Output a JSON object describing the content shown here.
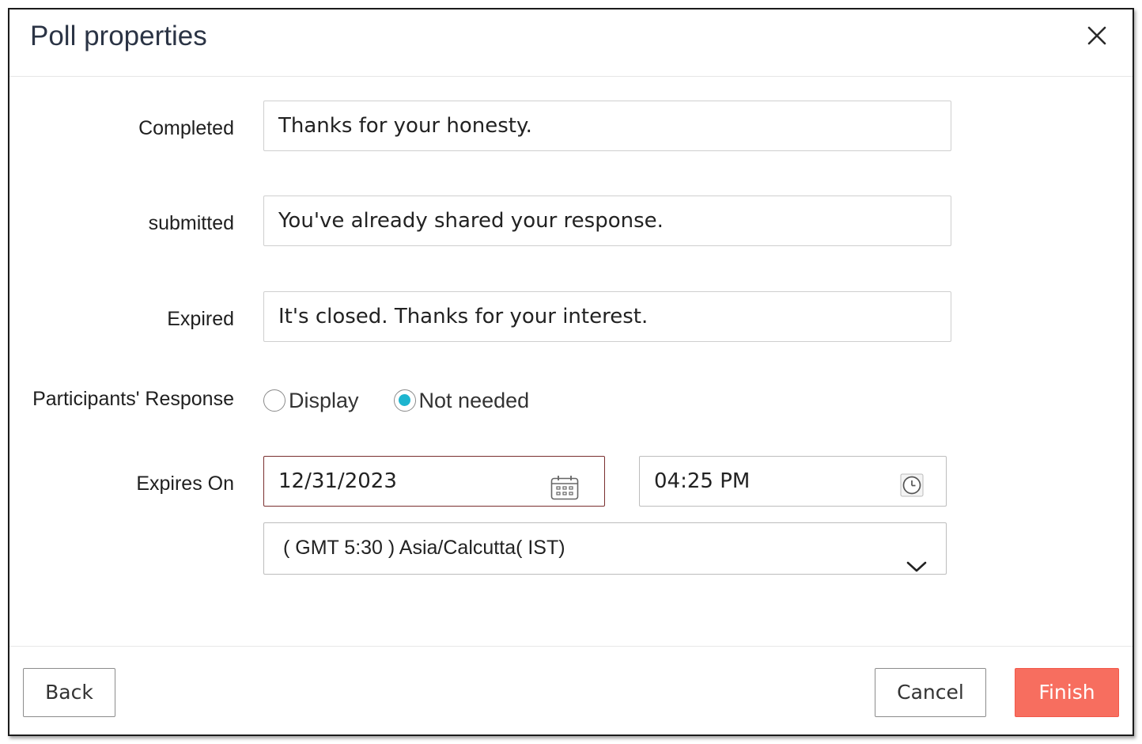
{
  "dialog": {
    "title": "Poll properties"
  },
  "form": {
    "completed": {
      "label": "Completed",
      "value": "Thanks for your honesty."
    },
    "submitted": {
      "label": "submitted",
      "value": "You've already shared your response."
    },
    "expired": {
      "label": "Expired",
      "value": "It's closed. Thanks for your interest."
    },
    "participants_response": {
      "label": "Participants' Response",
      "options": [
        "Display",
        "Not needed"
      ],
      "selected": "Not needed"
    },
    "expires_on": {
      "label": "Expires On",
      "date": "12/31/2023",
      "time": "04:25 PM",
      "timezone": "( GMT 5:30 ) Asia/Calcutta( IST)"
    }
  },
  "footer": {
    "back_label": "Back",
    "cancel_label": "Cancel",
    "finish_label": "Finish"
  },
  "colors": {
    "accent_radio": "#1eb5cf",
    "finish_button": "#f76e5f",
    "date_border": "#7a2f2f"
  },
  "icons": {
    "close": "close-icon",
    "calendar": "calendar-icon",
    "clock": "clock-icon",
    "dropdown": "chevron-down-icon"
  }
}
